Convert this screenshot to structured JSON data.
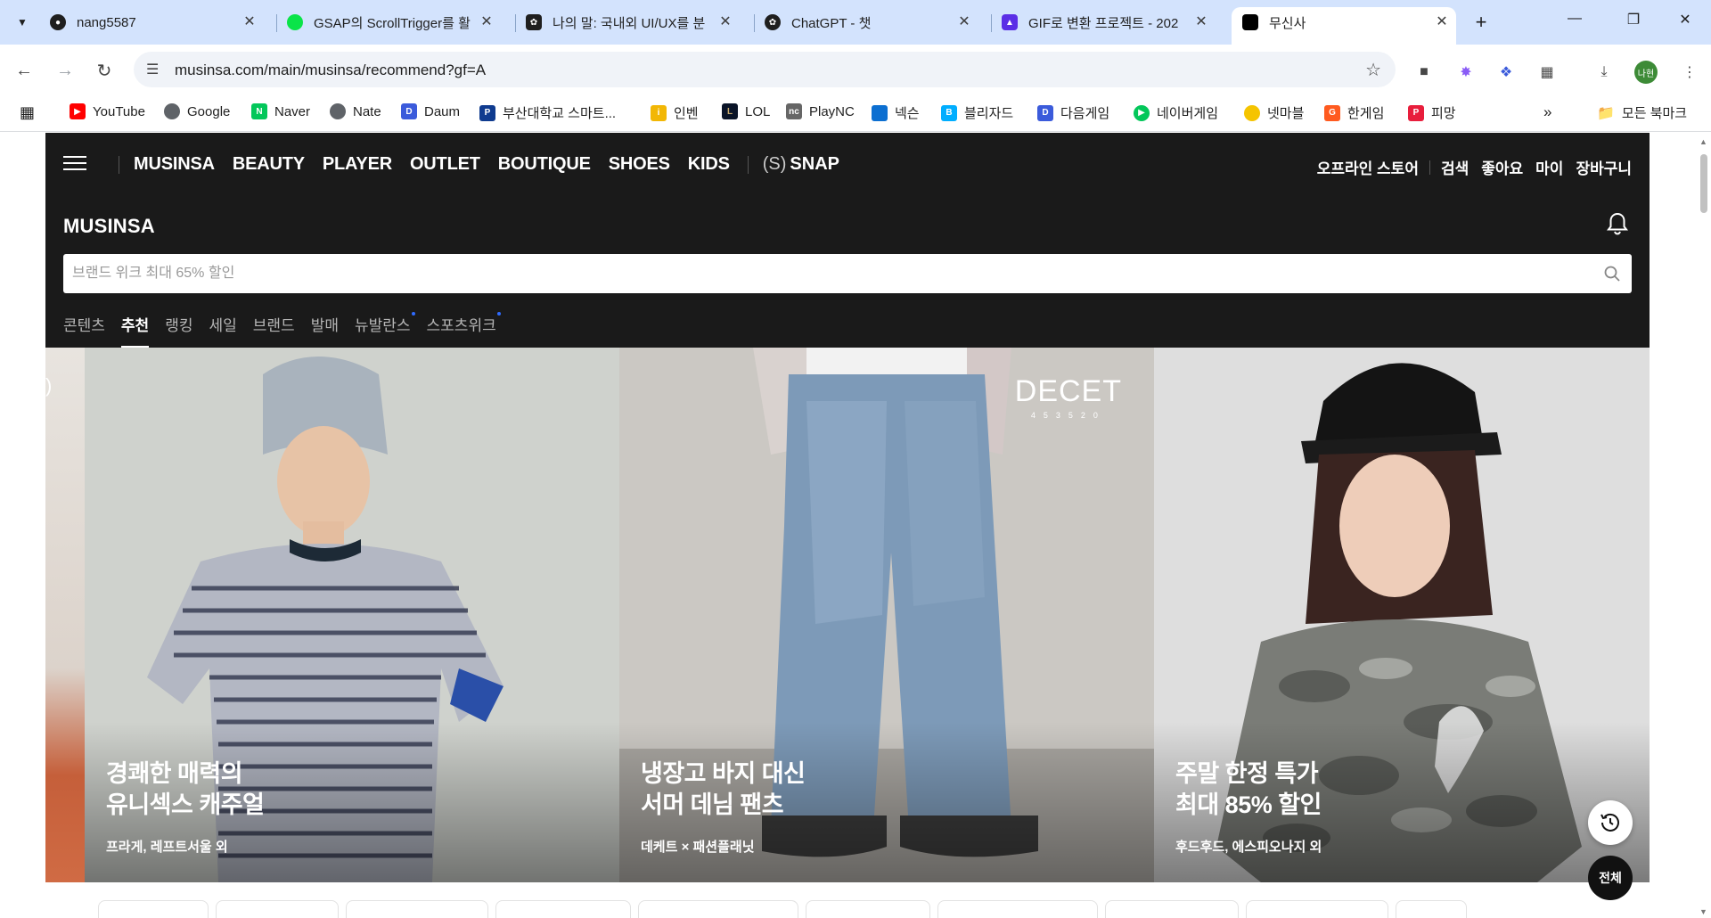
{
  "browser": {
    "tabs": [
      {
        "title": "nang5587",
        "icon": "github-icon",
        "color": "#1f1f1f"
      },
      {
        "title": "GSAP의 ScrollTrigger를 활",
        "icon": "gsap-icon",
        "color": "#0ae448"
      },
      {
        "title": "나의 말: 국내외 UI/UX를 분",
        "icon": "openai-icon",
        "color": "#1f1f1f"
      },
      {
        "title": "ChatGPT - 챗",
        "icon": "openai-icon",
        "color": "#1f1f1f"
      },
      {
        "title": "GIF로 변환 프로젝트 - 202",
        "icon": "app-icon",
        "color": "#5b2ee6"
      },
      {
        "title": "무신사",
        "icon": "musinsa-icon",
        "color": "#000000"
      }
    ],
    "url": "musinsa.com/main/musinsa/recommend?gf=A",
    "profile_initials": "나현",
    "bookmarks": [
      {
        "label": "YouTube",
        "color": "#ff0000"
      },
      {
        "label": "Google",
        "color": "#5f6368"
      },
      {
        "label": "Naver",
        "color": "#03c75a"
      },
      {
        "label": "Nate",
        "color": "#5f6368"
      },
      {
        "label": "Daum",
        "color": "#3b5bdb"
      },
      {
        "label": "부산대학교 스마트...",
        "color": "#0f3b8f"
      },
      {
        "label": "인벤",
        "color": "#f2b705"
      },
      {
        "label": "LOL",
        "color": "#0a1428"
      },
      {
        "label": "PlayNC",
        "color": "#666666"
      },
      {
        "label": "넥슨",
        "color": "#0c6fd1"
      },
      {
        "label": "블리자드",
        "color": "#00aeff"
      },
      {
        "label": "다음게임",
        "color": "#3b5bdb"
      },
      {
        "label": "네이버게임",
        "color": "#03c75a"
      },
      {
        "label": "넷마블",
        "color": "#f5c400"
      },
      {
        "label": "한게임",
        "color": "#ff5a1f"
      },
      {
        "label": "피망",
        "color": "#e81e3c"
      }
    ],
    "all_bookmarks": "모든 북마크"
  },
  "site": {
    "gnb": [
      "MUSINSA",
      "BEAUTY",
      "PLAYER",
      "OUTLET",
      "BOUTIQUE",
      "SHOES",
      "KIDS"
    ],
    "snap_prefix": "(S)",
    "snap_label": "SNAP",
    "util": {
      "offline": "오프라인 스토어",
      "search": "검색",
      "like": "좋아요",
      "my": "마이",
      "cart": "장바구니"
    },
    "logo": "MUSINSA",
    "search_placeholder": "브랜드 위크 최대 65% 할인",
    "categories": [
      {
        "label": "콘텐츠",
        "active": false,
        "dot": false
      },
      {
        "label": "추천",
        "active": true,
        "dot": false
      },
      {
        "label": "랭킹",
        "active": false,
        "dot": false
      },
      {
        "label": "세일",
        "active": false,
        "dot": false
      },
      {
        "label": "브랜드",
        "active": false,
        "dot": false
      },
      {
        "label": "발매",
        "active": false,
        "dot": false
      },
      {
        "label": "뉴발란스",
        "active": false,
        "dot": true
      },
      {
        "label": "스포츠위크",
        "active": false,
        "dot": true
      }
    ],
    "peek_text": ")",
    "banners": [
      {
        "headline": "경쾌한 매력의\n유니섹스 캐주얼",
        "sub": "프라게, 레프트서울 외"
      },
      {
        "headline": "냉장고 바지 대신\n서머 데님 팬츠",
        "sub": "데케트 × 패션플래닛",
        "logo_big": "DECET",
        "logo_small": "453520"
      },
      {
        "headline": "주말 한정 특가\n최대 85% 할인",
        "sub": "후드후드, 에스피오나지 외"
      }
    ],
    "all_button": "전체"
  }
}
